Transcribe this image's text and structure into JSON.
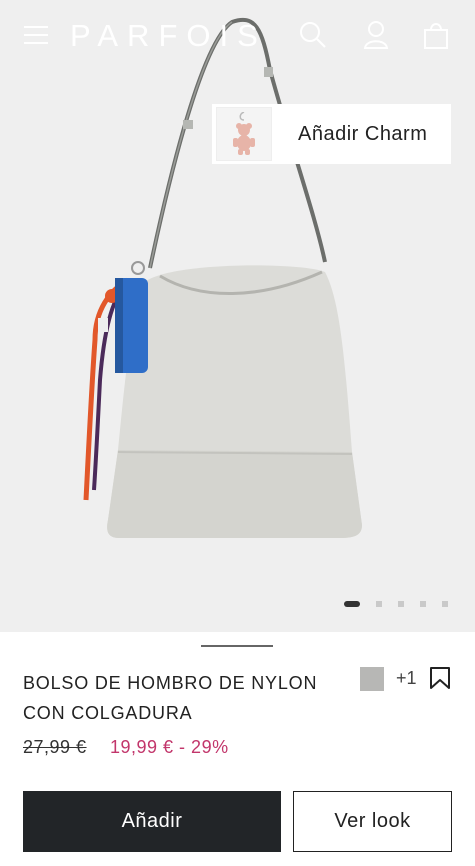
{
  "header": {
    "logo": "PARFOIS",
    "icons": [
      "menu-icon",
      "search-icon",
      "user-icon",
      "shopping-bag-icon"
    ]
  },
  "charm_overlay": {
    "label": "Añadir Charm",
    "thumb_icon": "teddy-bear-charm-icon"
  },
  "gallery": {
    "total_images": 5,
    "active_index": 0
  },
  "product": {
    "name": "BOLSO DE HOMBRO DE NYLON CON COLGADURA",
    "color_swatch": "#b7b7b5",
    "more_colors": "+1",
    "price_original": "27,99 €",
    "price_sale": "19,99 € - 29%",
    "sale_color": "#c2366b"
  },
  "actions": {
    "add_label": "Añadir",
    "look_label": "Ver look"
  }
}
